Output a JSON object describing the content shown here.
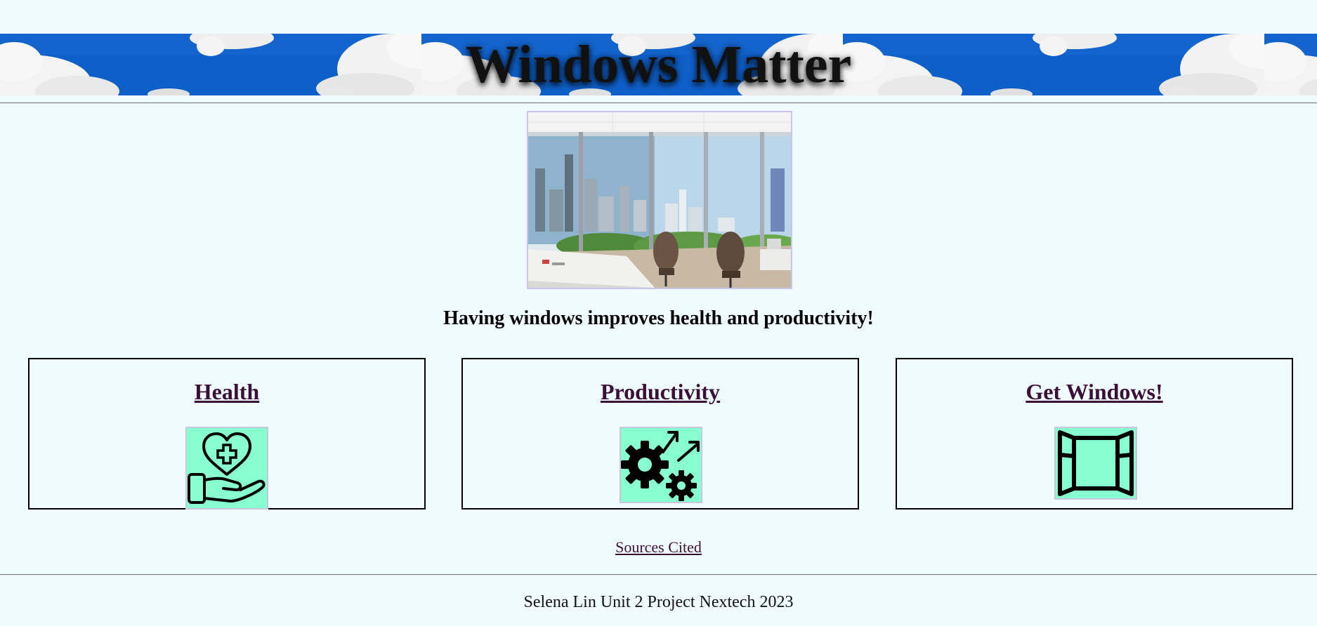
{
  "header": {
    "title": "Windows Matter"
  },
  "hero": {
    "image_alt": "office-with-city-view-windows"
  },
  "tagline": "Having windows improves health and productivity!",
  "cards": [
    {
      "label": "Health",
      "icon": "heart-in-hand-icon"
    },
    {
      "label": "Productivity",
      "icon": "gears-arrows-icon"
    },
    {
      "label": "Get Windows!",
      "icon": "open-window-icon"
    }
  ],
  "sources": {
    "label": "Sources Cited"
  },
  "footer": {
    "text": "Selena Lin Unit 2 Project Nextech 2023"
  },
  "colors": {
    "background": "#f0fbff",
    "sky_blue": "#0f5fc8",
    "link_visited": "#3b1038",
    "icon_background": "#88ffd0"
  }
}
